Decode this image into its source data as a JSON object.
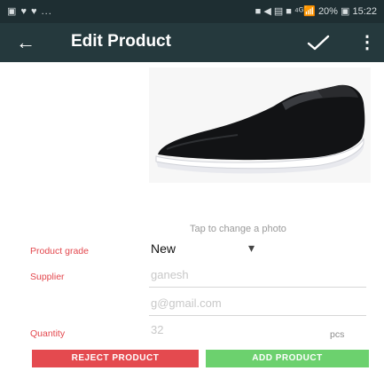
{
  "status_bar": {
    "left_icons": "▣ ♥ ♥ ...",
    "right_text": "■ ◀ ▤ ■ ⁴ᴳ📶 20% ▣ 15:22"
  },
  "app_bar": {
    "back_glyph": "←",
    "title": "Edit Product",
    "more_glyph": "⋮"
  },
  "photo": {
    "hint": "Tap to change a photo"
  },
  "form": {
    "grade_label": "Product grade",
    "grade_value": "New",
    "grade_caret": "▾",
    "supplier_label": "Supplier",
    "supplier_name": "ganesh",
    "supplier_email": "g@gmail.com",
    "quantity_label": "Quantity",
    "quantity_value": "32",
    "quantity_unit": "pcs"
  },
  "actions": {
    "reject_label": "REJECT PRODUCT",
    "add_label": "ADD PRODUCT"
  },
  "colors": {
    "app_bar": "#25393d",
    "label_red": "#e3474d",
    "reject_button": "#e44a4f",
    "add_button": "#6cd16e"
  },
  "icons": {
    "back": "arrow-left-icon",
    "confirm": "check-icon",
    "overflow": "more-vert-icon"
  }
}
